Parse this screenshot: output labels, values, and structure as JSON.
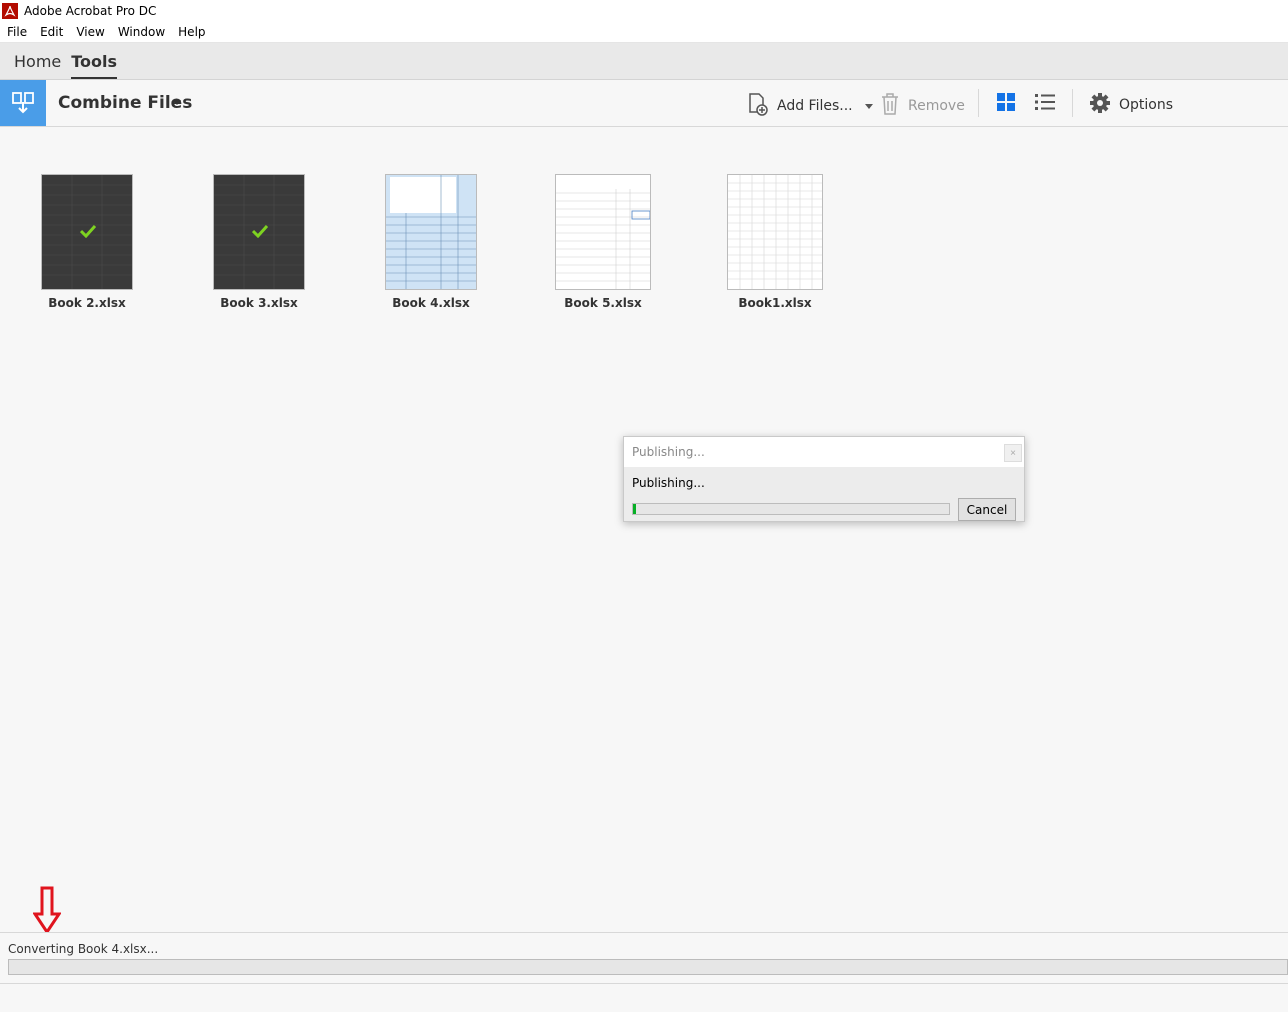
{
  "window": {
    "title": "Adobe Acrobat Pro DC"
  },
  "menu": [
    "File",
    "Edit",
    "View",
    "Window",
    "Help"
  ],
  "tabs": [
    {
      "label": "Home",
      "active": false
    },
    {
      "label": "Tools",
      "active": true
    }
  ],
  "toolbar": {
    "tool_name": "Combine Files",
    "add_files_label": "Add Files...",
    "remove_label": "Remove",
    "options_label": "Options",
    "accent_color": "#4a9de8"
  },
  "files": [
    {
      "name": "Book 2.xlsx",
      "style": "dark",
      "converted": true
    },
    {
      "name": "Book 3.xlsx",
      "style": "dark",
      "converted": true
    },
    {
      "name": "Book 4.xlsx",
      "style": "light-blue",
      "converted": false
    },
    {
      "name": "Book 5.xlsx",
      "style": "light",
      "converted": false
    },
    {
      "name": "Book1.xlsx",
      "style": "light-grid",
      "converted": false
    }
  ],
  "dialog": {
    "title": "Publishing...",
    "message": "Publishing...",
    "cancel_label": "Cancel",
    "close_glyph": "×",
    "progress_percent": 1
  },
  "status": {
    "text": "Converting Book 4.xlsx...",
    "progress_percent": 0
  }
}
